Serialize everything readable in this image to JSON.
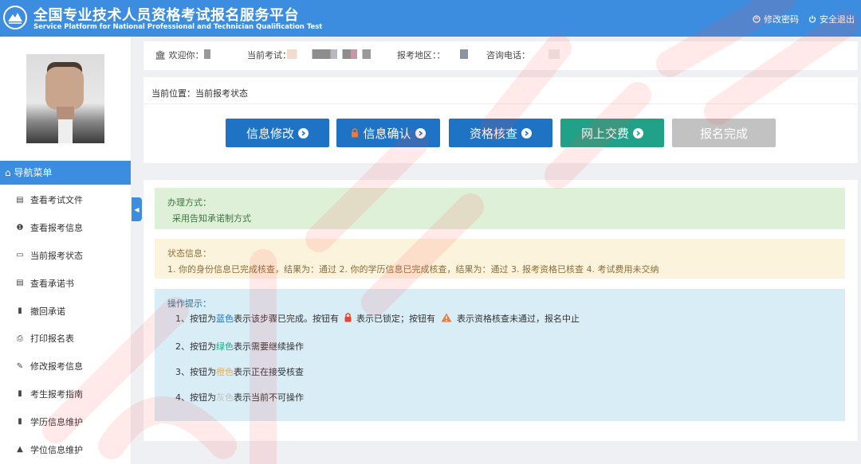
{
  "header": {
    "title_cn": "全国专业技术人员资格考试报名服务平台",
    "title_en": "Service Platform for National Professional and Technician Qualification Test",
    "change_password": "修改密码",
    "logout": "安全退出"
  },
  "infobar": {
    "welcome": "欢迎你：",
    "exam": "当前考试：",
    "region": "报考地区：：",
    "phone": "咨询电话："
  },
  "breadcrumb": "当前位置：当前报考状态",
  "steps": [
    {
      "label": "信息修改",
      "color": "#1e73c4",
      "locked": false
    },
    {
      "label": "信息确认",
      "color": "#1e73c4",
      "locked": true
    },
    {
      "label": "资格核查",
      "color": "#1e73c4",
      "locked": false
    },
    {
      "label": "网上交费",
      "color": "#21a288",
      "locked": false
    },
    {
      "label": "报名完成",
      "color": "#c2c2c2",
      "locked": false
    }
  ],
  "sidebar": {
    "nav_title": "导航菜单",
    "items": [
      {
        "label": "查看考试文件",
        "icon": "document-icon"
      },
      {
        "label": "查看报考信息",
        "icon": "info-icon"
      },
      {
        "label": "当前报考状态",
        "icon": "monitor-icon"
      },
      {
        "label": "查看承诺书",
        "icon": "card-icon"
      },
      {
        "label": "撤回承诺",
        "icon": "book-icon"
      },
      {
        "label": "打印报名表",
        "icon": "print-icon"
      },
      {
        "label": "修改报考信息",
        "icon": "edit-icon"
      },
      {
        "label": "考生报考指南",
        "icon": "guide-icon"
      },
      {
        "label": "学历信息维护",
        "icon": "file-icon"
      },
      {
        "label": "学位信息维护",
        "icon": "graduation-cap-icon"
      }
    ]
  },
  "panels": {
    "way_title": "办理方式：",
    "way_text": "采用告知承诺制方式",
    "status_title": "状态信息：",
    "status_text": "1. 你的身份信息已完成核查，结果为：通过 2. 你的学历信息已完成核查，结果为：通过 3. 报考资格已核查 4. 考试费用未交纳",
    "tips_title": "操作提示：",
    "tip1": {
      "a": "1、按钮为",
      "b": "蓝色",
      "c": "表示该步骤已完成。按钮有",
      "d": "表示已锁定；按钮有",
      "e": "表示资格核查未通过，报名中止"
    },
    "tip2": {
      "a": "2、按钮为",
      "b": "绿色",
      "c": "表示需要继续操作"
    },
    "tip3": {
      "a": "3、按钮为",
      "b": "橙色",
      "c": "表示正在接受核查"
    },
    "tip4": {
      "a": "4、按钮为",
      "b": "灰色",
      "c": "表示当前不可操作"
    }
  },
  "colors": {
    "primary": "#3c8ddf",
    "blue": "#1e73c4",
    "green": "#21a288",
    "orange": "#f0ad4e",
    "grey": "#c2c2c2"
  }
}
